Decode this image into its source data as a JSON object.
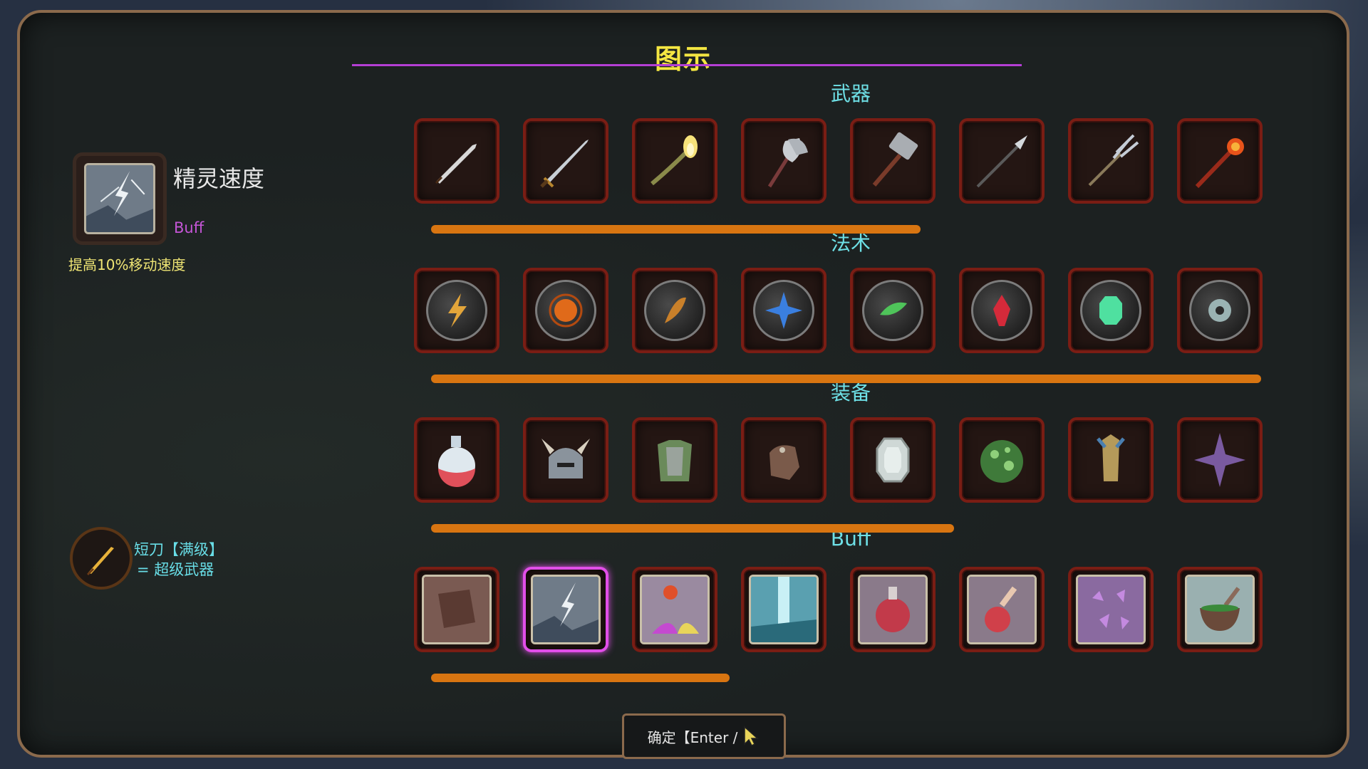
{
  "title": "图示",
  "sections": {
    "weapons": {
      "label": "武器",
      "icons": [
        "dagger-icon",
        "sword-icon",
        "torch-icon",
        "battle-axe-icon",
        "war-hammer-icon",
        "spear-icon",
        "trident-icon",
        "fire-staff-icon"
      ],
      "progress_fraction": 0.59
    },
    "spells": {
      "label": "法术",
      "icons": [
        "lightning-rune-icon",
        "orange-orb-rune-icon",
        "feather-rune-icon",
        "blue-star-rune-icon",
        "green-leaf-rune-icon",
        "red-crystal-rune-icon",
        "emerald-rune-icon",
        "ring-rune-icon"
      ],
      "progress_fraction": 1.0
    },
    "equipment": {
      "label": "装备",
      "icons": [
        "potion-icon",
        "horned-helmet-icon",
        "armor-icon",
        "gauntlet-icon",
        "gem-amulet-icon",
        "spotted-egg-icon",
        "dragon-totem-icon",
        "purple-star-icon"
      ],
      "progress_fraction": 0.63
    },
    "buffs": {
      "label": "Buff",
      "icons": [
        "spellbook-card-icon",
        "lightning-card-icon",
        "alchemy-card-icon",
        "waterfall-card-icon",
        "red-potion-card-icon",
        "flask-card-icon",
        "crystals-card-icon",
        "mortar-card-icon"
      ],
      "selected_index": 1,
      "progress_fraction": 0.36
    }
  },
  "detail": {
    "name": "精灵速度",
    "type": "Buff",
    "description": "提高10%移动速度",
    "icon": "lightning-card-icon"
  },
  "combo": {
    "icon": "dagger-icon",
    "line1": "短刀【满级】",
    "line2": "= 超级武器"
  },
  "confirm": {
    "label": "确定【Enter /",
    "icon": "mouse-cursor-icon"
  },
  "colors": {
    "title": "#f4e642",
    "section_label": "#6ee0e6",
    "progress": "#d87511",
    "selected": "#e14ee8",
    "slot_border": "#7a1d14"
  }
}
